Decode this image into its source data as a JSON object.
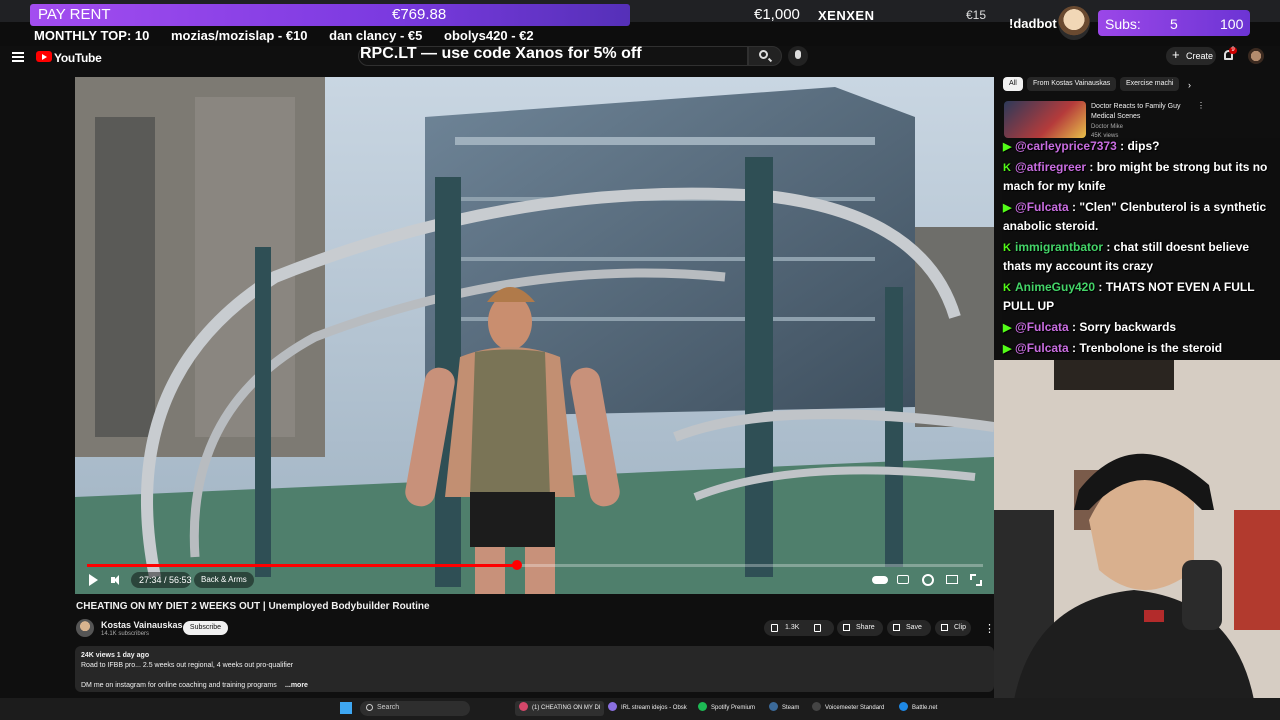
{
  "overlay": {
    "rent_label": "PAY RENT",
    "rent_amount": "€769.88",
    "rent_goal": "€1,000",
    "streamer": "XENXEN",
    "small_amount": "€15",
    "bot_label": "!dadbot",
    "subs_label": "Subs:",
    "subs_count": "5",
    "subs_goal": "100",
    "ticker_title": "MONTHLY TOP: 10",
    "ticker_items": [
      "mozias/mozislap - €10",
      "dan clancy - €5",
      "obolys420 - €2"
    ]
  },
  "header": {
    "logo_text": "YouTube",
    "search_overlay": "RPC.LT — use code Xanos for 5% off",
    "create_label": "Create",
    "bell_badge": "9"
  },
  "player": {
    "current_time": "27:34 / 56:53",
    "chapter": "Back & Arms",
    "progress": 0.48
  },
  "video": {
    "title": "CHEATING ON MY DIET 2 WEEKS OUT | Unemployed Bodybuilder Routine",
    "channel": "Kostas Vainauskas",
    "subscribers": "14.1K subscribers",
    "subscribe_label": "Subscribe",
    "likes": "1.3K",
    "share_label": "Share",
    "save_label": "Save",
    "clip_label": "Clip",
    "stats": "24K views  1 day ago",
    "desc_line1": "Road to IFBB pro... 2.5 weeks out regional, 4 weeks out pro-qualifier",
    "desc_line2": "DM me on instagram for online coaching and training programs",
    "more_label": "...more"
  },
  "sidebar": {
    "chips": [
      "All",
      "From Kostas Vainauskas",
      "Exercise machi"
    ],
    "rec": {
      "title": "Doctor Reacts to Family Guy Medical Scenes",
      "channel": "Doctor Mike",
      "meta": "45K views"
    }
  },
  "chat": [
    {
      "user": "@carleyprice7373",
      "text": " : dips?",
      "color": "pink"
    },
    {
      "user": "@atfiregreer",
      "text": " : bro might be strong but its no mach for my knife",
      "color": "pink"
    },
    {
      "user": "@Fulcata",
      "text": " : \"Clen\" Clenbuterol is a synthetic anabolic steroid.",
      "color": "pink"
    },
    {
      "user": "immigrantbator",
      "text": " : chat still doesnt believe thats my account its crazy",
      "color": "green"
    },
    {
      "user": "AnimeGuy420",
      "text": " : THATS NOT EVEN A FULL PULL UP",
      "color": "green"
    },
    {
      "user": "@Fulcata",
      "text": " : Sorry backwards",
      "color": "pink"
    },
    {
      "user": "@Fulcata",
      "text": " : Trenbolone is the steroid",
      "color": "pink"
    }
  ],
  "taskbar": {
    "search_text": "Search",
    "apps": [
      "(1) CHEATING ON MY DI",
      "IRL stream idejos - Obsk",
      "Spotify Premium",
      "Steam",
      "Voicemeeter Standard",
      "Battle.net"
    ]
  },
  "colors": {
    "rent_bar": "#a34df0",
    "progress": "#ff0000",
    "youtube_red": "#ff0000",
    "kick_green": "#53fc18"
  }
}
